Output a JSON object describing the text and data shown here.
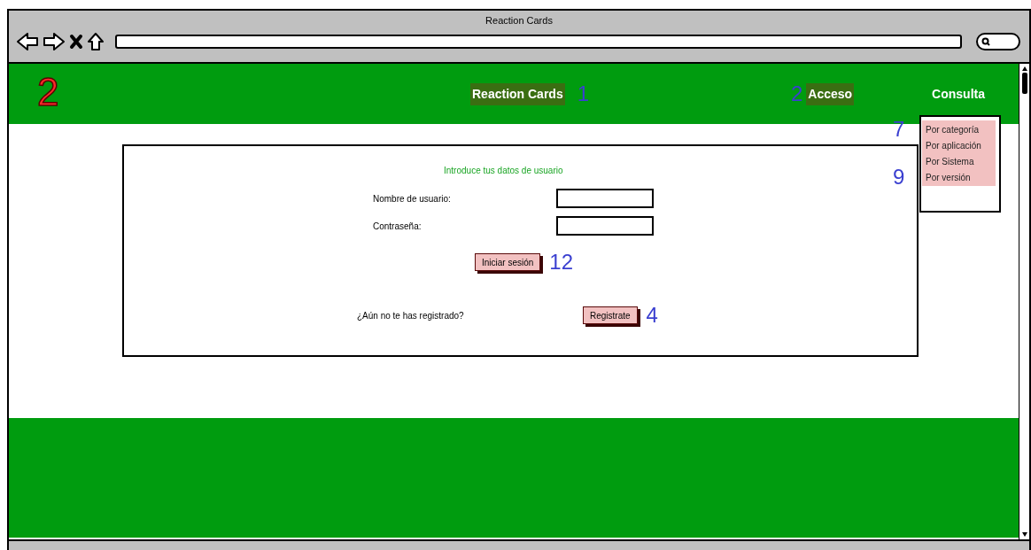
{
  "browser": {
    "title": "Reaction Cards"
  },
  "header": {
    "badge": "2",
    "brand": {
      "label": "Reaction Cards",
      "note": "1"
    },
    "nav": [
      {
        "label": "Acceso",
        "note": "2",
        "highlighted": true
      },
      {
        "label": "Consulta",
        "highlighted": false
      }
    ]
  },
  "dropdown": {
    "items": [
      {
        "label": "Por categoría",
        "note": "7"
      },
      {
        "label": "Por aplicación"
      },
      {
        "label": "Por Sistema"
      },
      {
        "label": "Por versión",
        "note": "9"
      }
    ]
  },
  "form": {
    "heading": "Introduce tus datos de usuario",
    "fields": [
      {
        "label": "Nombre de usuario:"
      },
      {
        "label": "Contraseña:"
      }
    ],
    "login_button": {
      "label": "Iniciar sesión",
      "note": "12"
    },
    "register_prompt": "¿Aún no te has registrado?",
    "register_button": {
      "label": "Registrate",
      "note": "4"
    }
  }
}
